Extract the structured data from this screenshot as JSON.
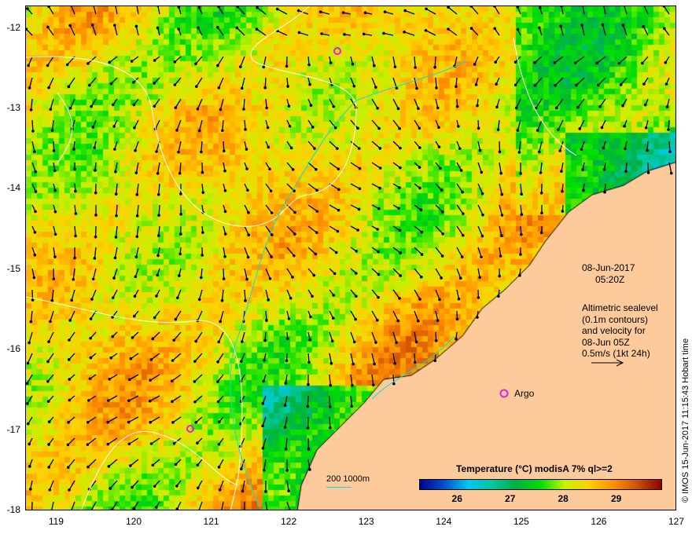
{
  "map": {
    "lon_range": [
      118.6,
      127
    ],
    "lat_range": [
      -18,
      -11.72
    ],
    "x_ticks": [
      "119",
      "120",
      "121",
      "122",
      "123",
      "124",
      "125",
      "126",
      "127"
    ],
    "y_ticks": [
      "-12",
      "-13",
      "-14",
      "-15",
      "-16",
      "-17",
      "-18"
    ],
    "land_color": "#fdcb9b"
  },
  "annotations": {
    "date": "08-Jun-2017",
    "time": "05:20Z",
    "altimetry_lines": [
      "Altimetric sealevel",
      "(0.1m contours)",
      "and velocity for",
      "08-Jun 05Z",
      "0.5m/s (1kt 24h)"
    ],
    "argo_label": "Argo",
    "scale_label": "200  1000m",
    "copyright": "© IMOS 15-Jun-2017 11:15:43 Hobart time"
  },
  "colorbar": {
    "title": "Temperature (°C) modisA 7% ql>=2",
    "ticks": [
      "26",
      "27",
      "28",
      "29"
    ],
    "range": [
      25.3,
      29.85
    ]
  }
}
